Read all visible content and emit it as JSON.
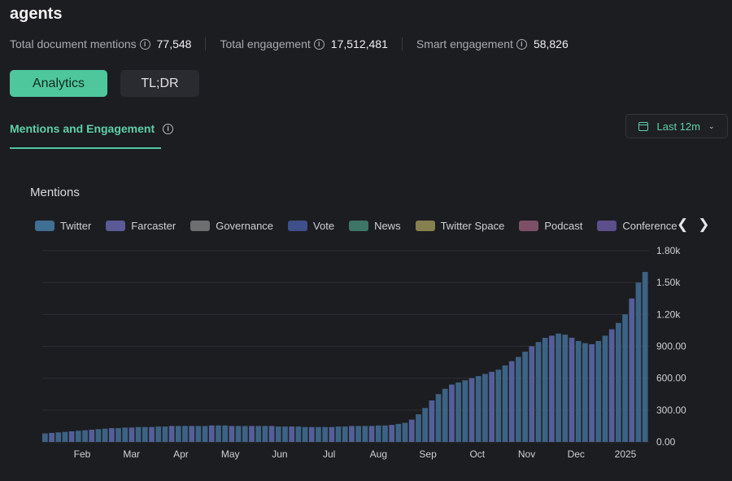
{
  "header": {
    "title": "agents",
    "stats": [
      {
        "label": "Total document mentions",
        "value": "77,548"
      },
      {
        "label": "Total engagement",
        "value": "17,512,481"
      },
      {
        "label": "Smart engagement",
        "value": "58,826"
      }
    ]
  },
  "buttons": {
    "analytics": "Analytics",
    "tldr": "TL;DR"
  },
  "tab": {
    "label": "Mentions and Engagement"
  },
  "range": {
    "label": "Last 12m"
  },
  "colors": {
    "accent": "#4fc79c",
    "bar": "#3d6384",
    "bar_alt": "#545f9a",
    "background": "#1c1d21"
  },
  "chart_data": {
    "type": "bar",
    "title": "Mentions",
    "legend": [
      {
        "name": "Twitter",
        "color": "#3f6f92"
      },
      {
        "name": "Farcaster",
        "color": "#5a5a96"
      },
      {
        "name": "Governance",
        "color": "#6d6e70"
      },
      {
        "name": "Vote",
        "color": "#3f4f8a"
      },
      {
        "name": "News",
        "color": "#3f7566"
      },
      {
        "name": "Twitter Space",
        "color": "#86804e"
      },
      {
        "name": "Podcast",
        "color": "#7d5068"
      },
      {
        "name": "Conference",
        "color": "#5c4f8a"
      }
    ],
    "x_ticks": [
      "Feb",
      "Mar",
      "Apr",
      "May",
      "Jun",
      "Jul",
      "Aug",
      "Sep",
      "Oct",
      "Nov",
      "Dec",
      "2025"
    ],
    "y_ticks": [
      "0.00",
      "300.00",
      "600.00",
      "900.00",
      "1.20k",
      "1.50k",
      "1.80k"
    ],
    "ylim": [
      0,
      1800
    ],
    "series": [
      {
        "values": [
          80,
          85,
          90,
          95,
          100,
          105,
          110,
          115,
          120,
          125,
          130,
          130,
          135,
          135,
          140,
          140,
          140,
          145,
          145,
          150,
          150,
          150,
          150,
          150,
          150,
          155,
          155,
          155,
          150,
          150,
          150,
          150,
          150,
          150,
          150,
          145,
          145,
          145,
          145,
          140,
          140,
          140,
          140,
          140,
          145,
          145,
          150,
          150,
          150,
          150,
          155,
          155,
          160,
          170,
          180,
          210,
          260,
          320,
          390,
          450,
          500,
          540,
          560,
          580,
          600,
          620,
          640,
          660,
          680,
          720,
          760,
          800,
          850,
          900,
          940,
          980,
          1000,
          1020,
          1010,
          980,
          950,
          930,
          920,
          950,
          1000,
          1060,
          1120,
          1200,
          1350,
          1500,
          1600
        ]
      }
    ]
  }
}
